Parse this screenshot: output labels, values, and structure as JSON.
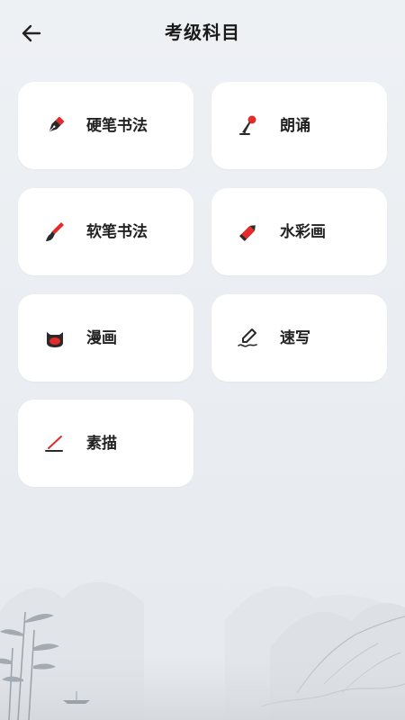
{
  "header": {
    "title": "考级科目"
  },
  "subjects": [
    {
      "label": "硬笔书法",
      "icon": "fountain-pen-icon"
    },
    {
      "label": "朗诵",
      "icon": "microphone-icon"
    },
    {
      "label": "软笔书法",
      "icon": "brush-icon"
    },
    {
      "label": "水彩画",
      "icon": "pencil-icon"
    },
    {
      "label": "漫画",
      "icon": "cartoon-face-icon"
    },
    {
      "label": "速写",
      "icon": "sketch-pen-icon"
    },
    {
      "label": "素描",
      "icon": "sketch-line-icon"
    }
  ],
  "colors": {
    "accent": "#e32b2b",
    "ink": "#2a2a2a",
    "background": "#eef1f4",
    "card": "#ffffff"
  }
}
